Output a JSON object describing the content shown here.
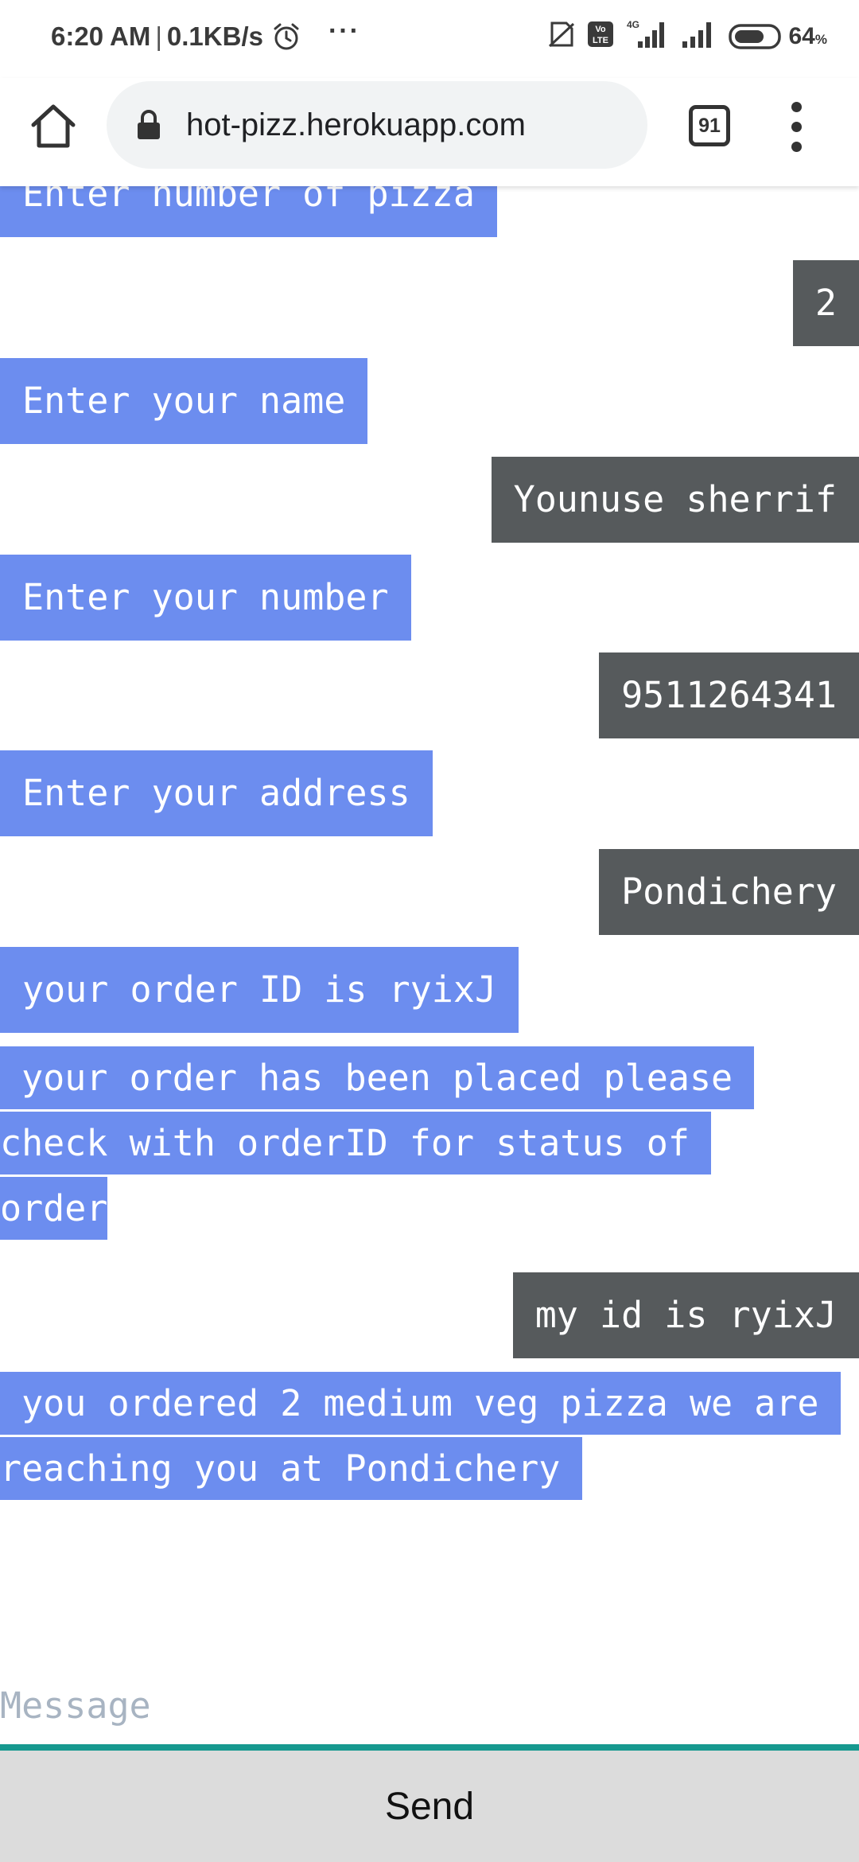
{
  "status_bar": {
    "time": "6:20 AM",
    "speed": "0.1KB/s",
    "more": "···",
    "network": "4G",
    "battery_level": "64",
    "battery_unit": "%"
  },
  "browser": {
    "url": "hot-pizz.herokuapp.com",
    "tab_count": "91"
  },
  "chat": {
    "messages": [
      {
        "from": "bot",
        "text": "Enter number of pizza"
      },
      {
        "from": "user",
        "text": "2"
      },
      {
        "from": "bot",
        "text": "Enter your name"
      },
      {
        "from": "user",
        "text": "Younuse sherrif"
      },
      {
        "from": "bot",
        "text": "Enter your number"
      },
      {
        "from": "user",
        "text": "9511264341"
      },
      {
        "from": "bot",
        "text": "Enter your address"
      },
      {
        "from": "user",
        "text": "Pondichery"
      },
      {
        "from": "bot",
        "text": "your order ID is ryixJ"
      },
      {
        "from": "bot",
        "text": " your order has been placed please check with orderID for status of order"
      },
      {
        "from": "user",
        "text": "my id is ryixJ"
      },
      {
        "from": "bot",
        "text": " you ordered 2 medium veg pizza we are reaching you at Pondichery "
      }
    ]
  },
  "composer": {
    "placeholder": "Message",
    "send_label": "Send"
  },
  "colors": {
    "bot_bubble": "#6c8def",
    "user_bubble": "#565a5c",
    "input_underline": "#16998f",
    "send_background": "#dcdcdc"
  }
}
